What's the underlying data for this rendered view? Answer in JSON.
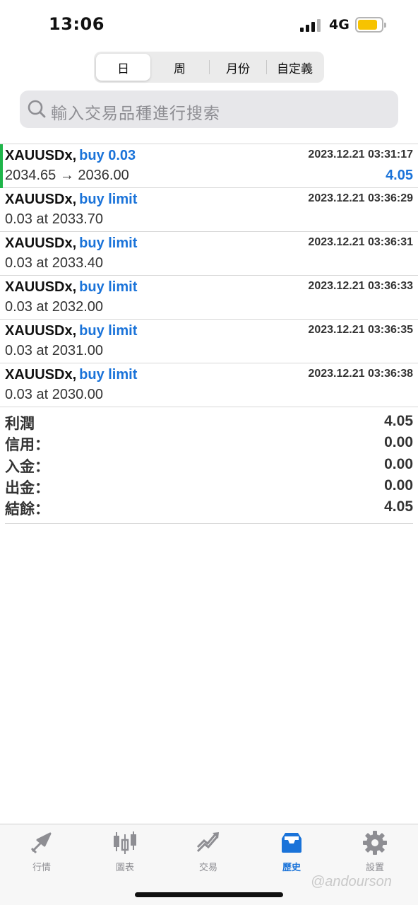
{
  "status_bar": {
    "time": "13:06",
    "network": "4G"
  },
  "period_tabs": [
    {
      "label": "日",
      "active": true
    },
    {
      "label": "周",
      "active": false
    },
    {
      "label": "月份",
      "active": false
    },
    {
      "label": "自定義",
      "active": false
    }
  ],
  "search": {
    "placeholder": "輸入交易品種進行搜索"
  },
  "history": [
    {
      "symbol": "XAUUSDx",
      "side": "buy 0.03",
      "time": "2023.12.21 03:31:17",
      "detail": "2034.65 → 2036.00",
      "profit": "4.05"
    },
    {
      "symbol": "XAUUSDx",
      "side": "buy limit",
      "time": "2023.12.21 03:36:29",
      "detail": "0.03 at 2033.70",
      "profit": ""
    },
    {
      "symbol": "XAUUSDx",
      "side": "buy limit",
      "time": "2023.12.21 03:36:31",
      "detail": "0.03 at 2033.40",
      "profit": ""
    },
    {
      "symbol": "XAUUSDx",
      "side": "buy limit",
      "time": "2023.12.21 03:36:33",
      "detail": "0.03 at 2032.00",
      "profit": ""
    },
    {
      "symbol": "XAUUSDx",
      "side": "buy limit",
      "time": "2023.12.21 03:36:35",
      "detail": "0.03 at 2031.00",
      "profit": ""
    },
    {
      "symbol": "XAUUSDx",
      "side": "buy limit",
      "time": "2023.12.21 03:36:38",
      "detail": "0.03 at 2030.00",
      "profit": ""
    }
  ],
  "summary": [
    {
      "label": "利潤",
      "value": "4.05"
    },
    {
      "label": "信用：",
      "value": "0.00"
    },
    {
      "label": "入金：",
      "value": "0.00"
    },
    {
      "label": "出金：",
      "value": "0.00"
    },
    {
      "label": "結餘：",
      "value": "4.05"
    }
  ],
  "tab_bar": [
    {
      "label": "行情",
      "icon": "quotes-icon",
      "active": false
    },
    {
      "label": "圖表",
      "icon": "chart-icon",
      "active": false
    },
    {
      "label": "交易",
      "icon": "trade-icon",
      "active": false
    },
    {
      "label": "歷史",
      "icon": "history-icon",
      "active": true
    },
    {
      "label": "設置",
      "icon": "settings-icon",
      "active": false
    }
  ],
  "watermark": "@andourson",
  "colors": {
    "accent": "#1a73d9",
    "open_position": "#1fb54a",
    "battery": "#f7c300"
  }
}
